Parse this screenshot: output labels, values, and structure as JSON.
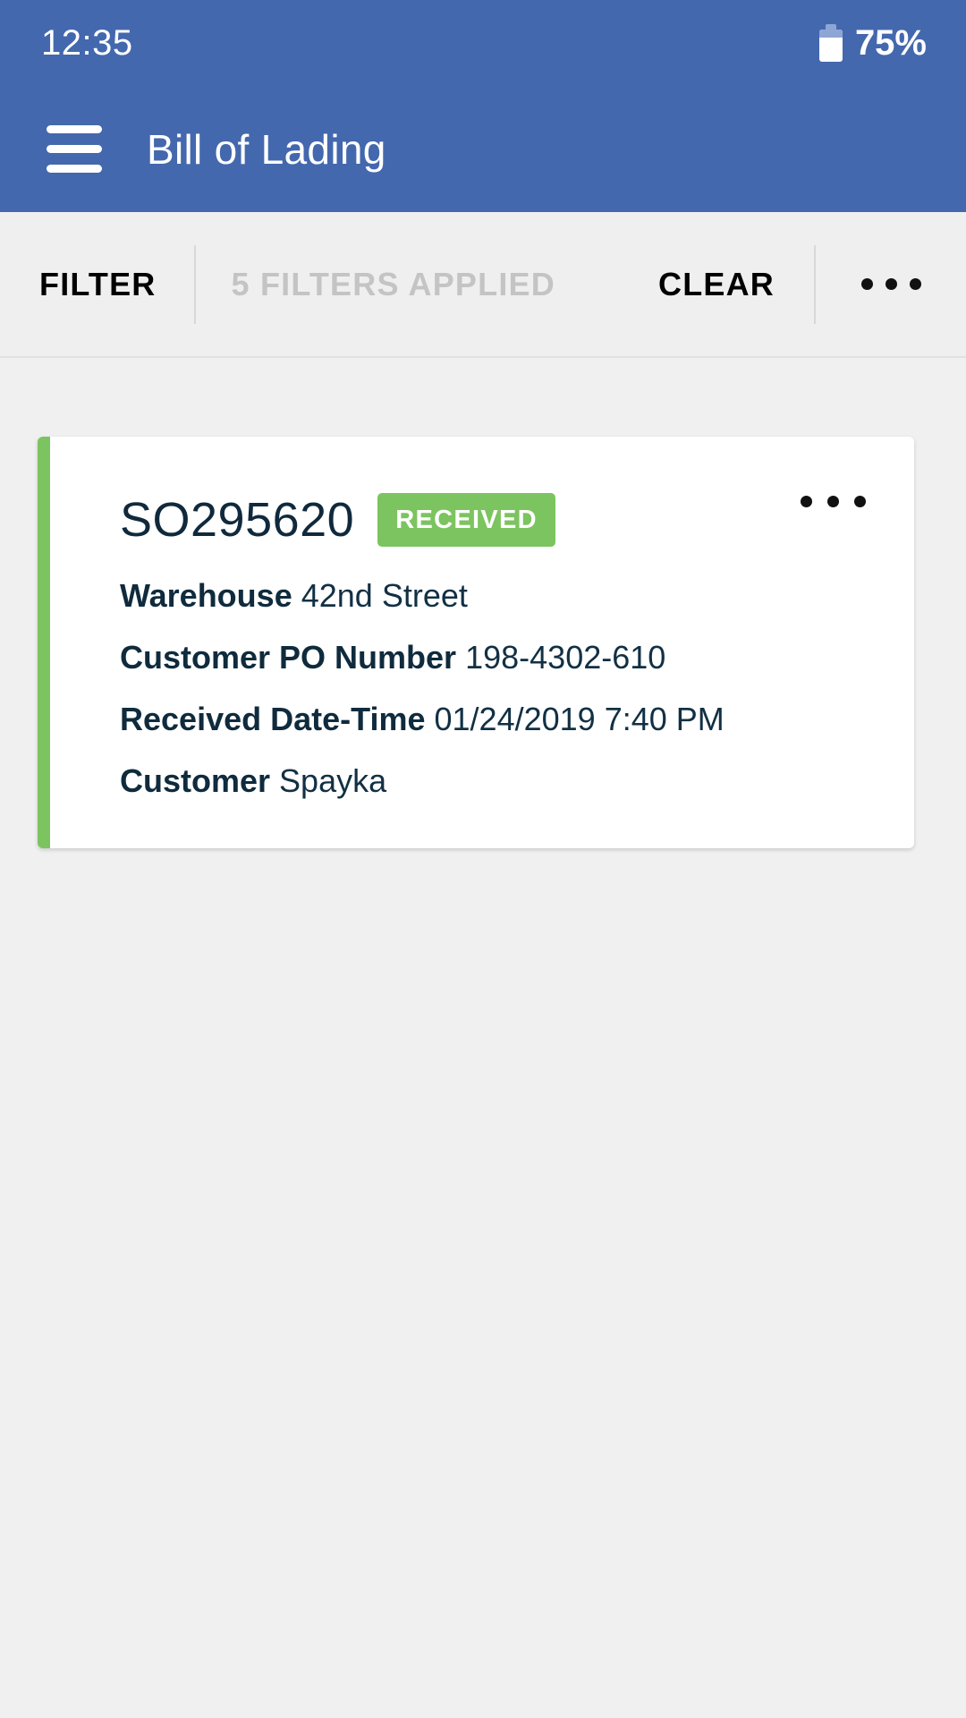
{
  "status_bar": {
    "time": "12:35",
    "battery_percent": "75%",
    "battery_icon": "battery-icon"
  },
  "app_bar": {
    "menu_icon": "hamburger-menu-icon",
    "title": "Bill of Lading"
  },
  "filter_bar": {
    "filter_label": "FILTER",
    "filters_applied_label": "5 FILTERS APPLIED",
    "clear_label": "CLEAR",
    "overflow_icon": "more-horizontal-icon"
  },
  "card": {
    "accent_color": "#7cc45f",
    "title": "SO295620",
    "status": "RECEIVED",
    "status_color": "#7cc45f",
    "overflow_icon": "more-horizontal-icon",
    "details": [
      {
        "label": "Warehouse",
        "value": "42nd Street"
      },
      {
        "label": "Customer PO Number",
        "value": "198-4302-610"
      },
      {
        "label": "Received Date-Time",
        "value": "01/24/2019 7:40 PM"
      },
      {
        "label": "Customer",
        "value": "Spayka"
      }
    ]
  },
  "theme": {
    "header_blue": "#4468ae",
    "background_gray": "#f0f0f0",
    "text_navy": "#0f2b3d"
  }
}
